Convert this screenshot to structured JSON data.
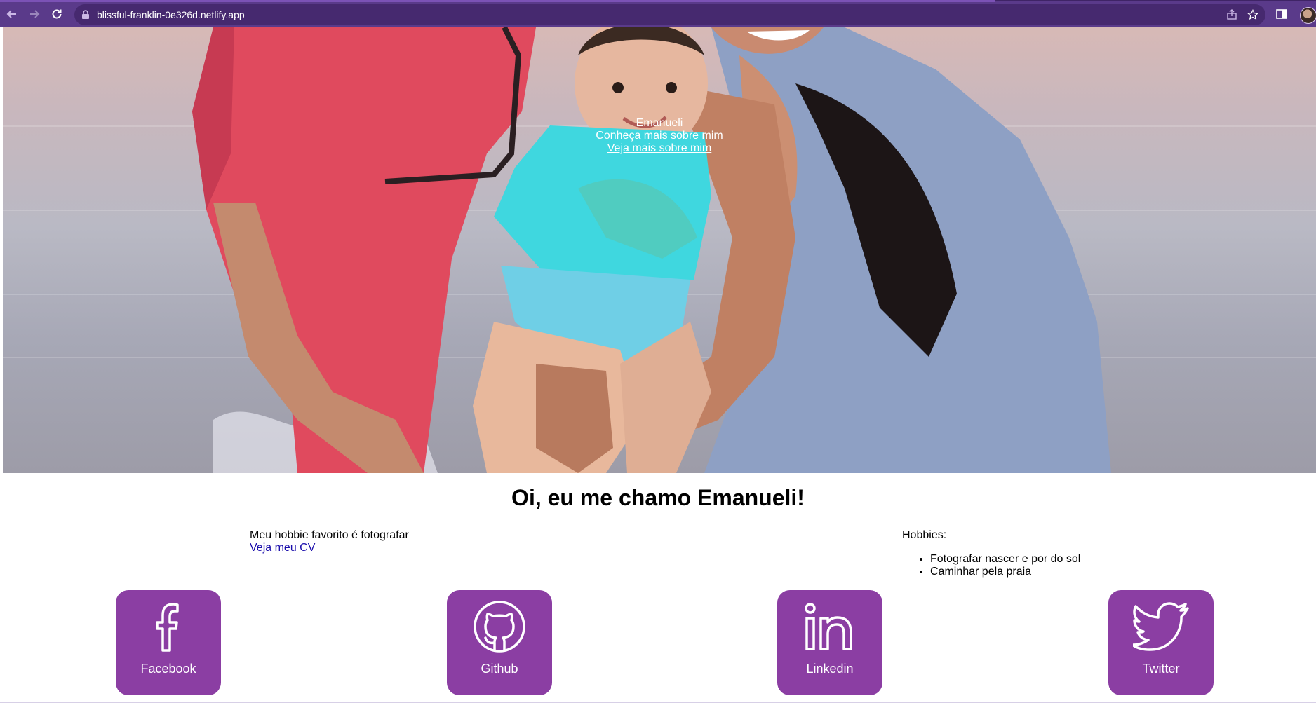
{
  "browser": {
    "url": "blissful-franklin-0e326d.netlify.app",
    "theme_color": "#5a3a8a"
  },
  "hero": {
    "name": "Emanueli",
    "tagline": "Conheça mais sobre mim",
    "link_label": "Veja mais sobre mim"
  },
  "intro": {
    "title": "Oi, eu me chamo Emanueli!",
    "favorite_hobby": "Meu hobbie favorito é fotografar",
    "cv_link": "Veja meu CV"
  },
  "hobbies": {
    "label": "Hobbies:",
    "items": [
      "Fotografar nascer e por do sol",
      "Caminhar pela praia"
    ]
  },
  "social": [
    {
      "label": "Facebook",
      "icon": "facebook-icon"
    },
    {
      "label": "Github",
      "icon": "github-icon"
    },
    {
      "label": "Linkedin",
      "icon": "linkedin-icon"
    },
    {
      "label": "Twitter",
      "icon": "twitter-icon"
    }
  ],
  "colors": {
    "accent": "#8b3ea3",
    "link": "#1a0dab"
  }
}
